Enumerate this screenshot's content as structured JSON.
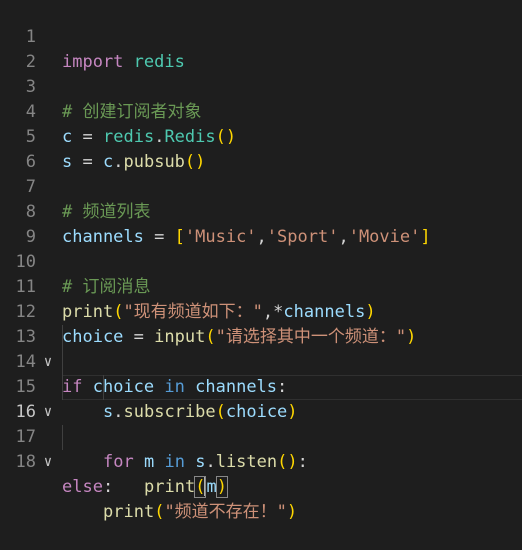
{
  "editor": {
    "line_numbers": [
      "1",
      "2",
      "3",
      "4",
      "5",
      "6",
      "7",
      "8",
      "9",
      "10",
      "11",
      "12",
      "13",
      "14",
      "15",
      "16",
      "17",
      "18"
    ],
    "lines": {
      "l1": {
        "kw": "import",
        "mod": "redis"
      },
      "l3": {
        "comment": "# 创建订阅者对象"
      },
      "l4": {
        "var": "c",
        "op": "=",
        "mod": "redis",
        "cls": "Redis",
        "paren_open": "(",
        "paren_close": ")"
      },
      "l5": {
        "var": "s",
        "op": "=",
        "obj": "c",
        "fn": "pubsub",
        "paren_open": "(",
        "paren_close": ")"
      },
      "l7": {
        "comment": "# 频道列表"
      },
      "l8": {
        "var": "channels",
        "op": "=",
        "br_open": "[",
        "s1": "'Music'",
        "s2": "'Sport'",
        "s3": "'Movie'",
        "br_close": "]"
      },
      "l10": {
        "comment": "# 订阅消息"
      },
      "l11": {
        "fn": "print",
        "paren_open": "(",
        "str": "\"现有频道如下：\"",
        "star": "*",
        "arg": "channels",
        "paren_close": ")"
      },
      "l12": {
        "var": "choice",
        "op": "=",
        "fn": "input",
        "paren_open": "(",
        "str": "\"请选择其中一个频道：\"",
        "paren_close": ")"
      },
      "l13": {
        "kw": "if",
        "var": "choice",
        "kw_in": "in",
        "var2": "channels",
        "colon": ":"
      },
      "l14": {
        "obj": "s",
        "fn": "subscribe",
        "paren_open": "(",
        "arg": "choice",
        "paren_close": ")"
      },
      "l15": {
        "kw": "for",
        "var": "m",
        "kw_in": "in",
        "obj": "s",
        "fn": "listen",
        "paren_open": "(",
        "paren_close": ")",
        "colon": ":"
      },
      "l16": {
        "fn": "print",
        "paren_open": "(",
        "arg": "m",
        "paren_close": ")"
      },
      "l17": {
        "kw": "else",
        "colon": ":"
      },
      "l18": {
        "fn": "print",
        "paren_open": "(",
        "str": "\"频道不存在！\"",
        "paren_close": ")"
      }
    },
    "fold_markers": {
      "l13": "chevron-down-icon",
      "l15": "chevron-down-icon",
      "l17": "chevron-down-icon"
    },
    "colors": {
      "background": "#1e1e1e",
      "line_number": "#858585",
      "control_keyword": "#c586c0",
      "keyword": "#569cd6",
      "function": "#dcdcaa",
      "variable": "#9cdcfe",
      "class": "#4ec9b0",
      "string": "#ce9178",
      "comment": "#6a9955",
      "bracket_level1": "#ffd700",
      "bracket_level2": "#da70d6"
    }
  }
}
